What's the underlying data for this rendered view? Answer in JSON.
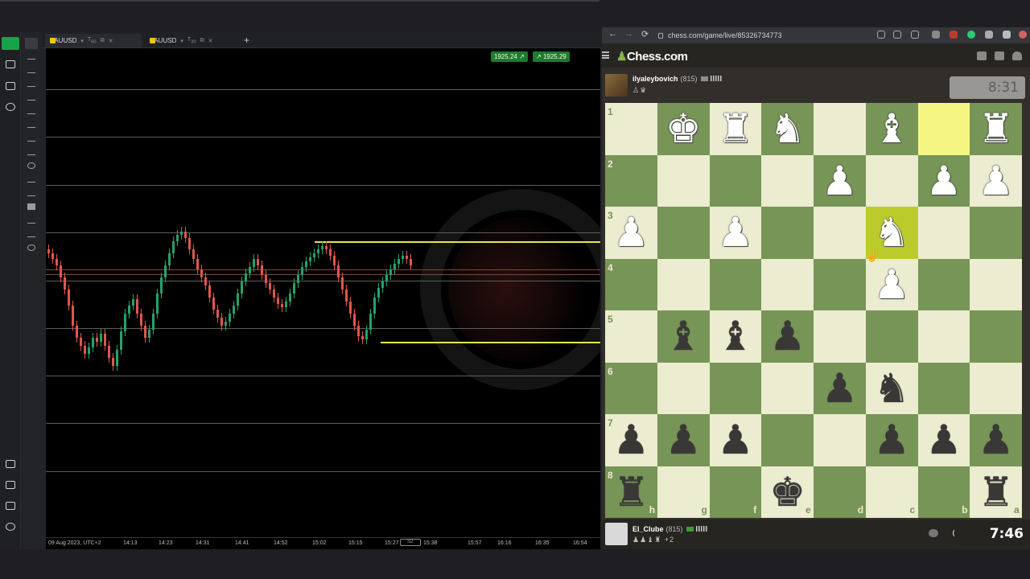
{
  "trading": {
    "tabs": [
      {
        "symbol": "XAUUSD",
        "tf": "T",
        "tf_sub": "60"
      },
      {
        "symbol": "XAUUSD",
        "tf": "T",
        "tf_sub": "30"
      }
    ],
    "add_tab": "+",
    "price_badges": [
      "1925.24",
      "1925.29"
    ],
    "x_ticks": [
      "09 Aug 2023, UTC+2",
      "14:13",
      "14:23",
      "14:31",
      "14:41",
      "14:52",
      "15:02",
      "15:15",
      "15:27",
      "15:38",
      "15:57",
      "16:16",
      "16:35",
      "16:54"
    ],
    "scroll_label": "S2",
    "colors": {
      "up": "#22a36a",
      "down": "#e0574a",
      "level": "#e6e65a",
      "badge": "#1f7a2e"
    }
  },
  "browser": {
    "url": "chess.com/game/live/85326734773",
    "nav": {
      "back": "←",
      "forward": "→",
      "reload": "⟳"
    }
  },
  "chess": {
    "logo_prefix": "♟",
    "logo": "Chess.com",
    "top_player": {
      "name": "ilyaleybovich",
      "rating": "(815)",
      "captured": "♙♛",
      "clock": "8:31"
    },
    "bottom_player": {
      "name": "El_Clube",
      "rating": "(815)",
      "captured": "♟♟♝♜",
      "material": "+2",
      "clock": "7:46"
    },
    "ranks": [
      "1",
      "2",
      "3",
      "4",
      "5",
      "6",
      "7",
      "8"
    ],
    "files": [
      "h",
      "g",
      "f",
      "e",
      "d",
      "c",
      "b",
      "a"
    ],
    "highlight": [
      "c3",
      "b1"
    ],
    "pieces": [
      {
        "sq": "g1",
        "p": "♚",
        "c": "w"
      },
      {
        "sq": "f1",
        "p": "♜",
        "c": "w"
      },
      {
        "sq": "e1",
        "p": "♞",
        "c": "w"
      },
      {
        "sq": "c1",
        "p": "♝",
        "c": "w"
      },
      {
        "sq": "a1",
        "p": "♜",
        "c": "w"
      },
      {
        "sq": "d2",
        "p": "♟",
        "c": "w"
      },
      {
        "sq": "b2",
        "p": "♟",
        "c": "w"
      },
      {
        "sq": "a2",
        "p": "♟",
        "c": "w"
      },
      {
        "sq": "h3",
        "p": "♟",
        "c": "w"
      },
      {
        "sq": "f3",
        "p": "♟",
        "c": "w"
      },
      {
        "sq": "c3",
        "p": "♞",
        "c": "w"
      },
      {
        "sq": "c4",
        "p": "♟",
        "c": "w"
      },
      {
        "sq": "g5",
        "p": "♝",
        "c": "b"
      },
      {
        "sq": "f5",
        "p": "♝",
        "c": "b"
      },
      {
        "sq": "e5",
        "p": "♟",
        "c": "b"
      },
      {
        "sq": "d6",
        "p": "♟",
        "c": "b"
      },
      {
        "sq": "c6",
        "p": "♞",
        "c": "b"
      },
      {
        "sq": "h7",
        "p": "♟",
        "c": "b"
      },
      {
        "sq": "g7",
        "p": "♟",
        "c": "b"
      },
      {
        "sq": "f7",
        "p": "♟",
        "c": "b"
      },
      {
        "sq": "c7",
        "p": "♟",
        "c": "b"
      },
      {
        "sq": "b7",
        "p": "♟",
        "c": "b"
      },
      {
        "sq": "a7",
        "p": "♟",
        "c": "b"
      },
      {
        "sq": "h8",
        "p": "♜",
        "c": "b"
      },
      {
        "sq": "e8",
        "p": "♚",
        "c": "b"
      },
      {
        "sq": "a8",
        "p": "♜",
        "c": "b"
      }
    ],
    "colors": {
      "light": "#ebecd0",
      "dark": "#779556",
      "highlight_light": "#f5f682",
      "highlight_dark": "#bbcb2b"
    }
  }
}
